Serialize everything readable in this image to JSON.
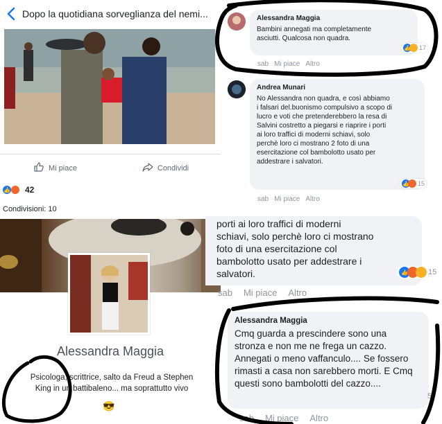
{
  "post": {
    "back_icon": "chevron-left-icon",
    "title": "Dopo la quotidiana sorveglianza del nemi...",
    "like_label": "Mi piace",
    "share_label": "Condividi",
    "reaction_count": "42",
    "shares": "Condivisioni: 10"
  },
  "profile": {
    "name": "Alessandra Maggia",
    "bio_line1": "Psicologa, scrittrice, salto da Freud a Stephen",
    "bio_line2": "King in un battibaleno... ma soprattutto vivo",
    "bio_emoji": "😎"
  },
  "comments": [
    {
      "author": "Alessandra Maggia",
      "text": "Bambini annegati ma completamente asciutti. Qualcosa non quadra.",
      "time": "sab",
      "like": "Mi piace",
      "reply": "Altro",
      "reactions": "17"
    },
    {
      "author": "Andrea Munari",
      "text": "No Alessandra non quadra, e così abbiamo i falsari del.buonismo compulsivo a scopo di lucro e voti che pretenderebbero la resa di Salvini costretto a piegarsi e riaprire i porti ai loro traffici di moderni schiavi, solo perchè loro ci mostrano 2 foto di una esercitazione col bambolotto usato per addestrare i salvatori.",
      "time": "sab",
      "like": "Mi piace",
      "reply": "Altro",
      "reactions": "15"
    }
  ],
  "crop": {
    "line1": "porti ai loro traffici di moderni",
    "line2": "schiavi, solo perchè loro ci mostrano",
    "line3": "foto di una esercitazione col",
    "line4": "bambolotto usato per addestrare i",
    "line5": "salvatori.",
    "time": "sab",
    "like": "Mi piace",
    "reply": "Altro",
    "reactions": "15"
  },
  "big_comment": {
    "author": "Alessandra Maggia",
    "text": "Cmq guarda a prescindere sono una stronza e non me ne frega un cazzo. Annegati o meno vaffanculo.... Se fossero rimasti a casa non sarebbero morti. E Cmq questi sono bambolotti del cazzo....",
    "time": "sab",
    "like": "Mi piace",
    "reply": "Altro",
    "reactions": "5"
  },
  "colors": {
    "fb_blue": "#1877f2",
    "marker": "#000000",
    "bubble": "#f0f2f5",
    "meta": "#90949c"
  }
}
